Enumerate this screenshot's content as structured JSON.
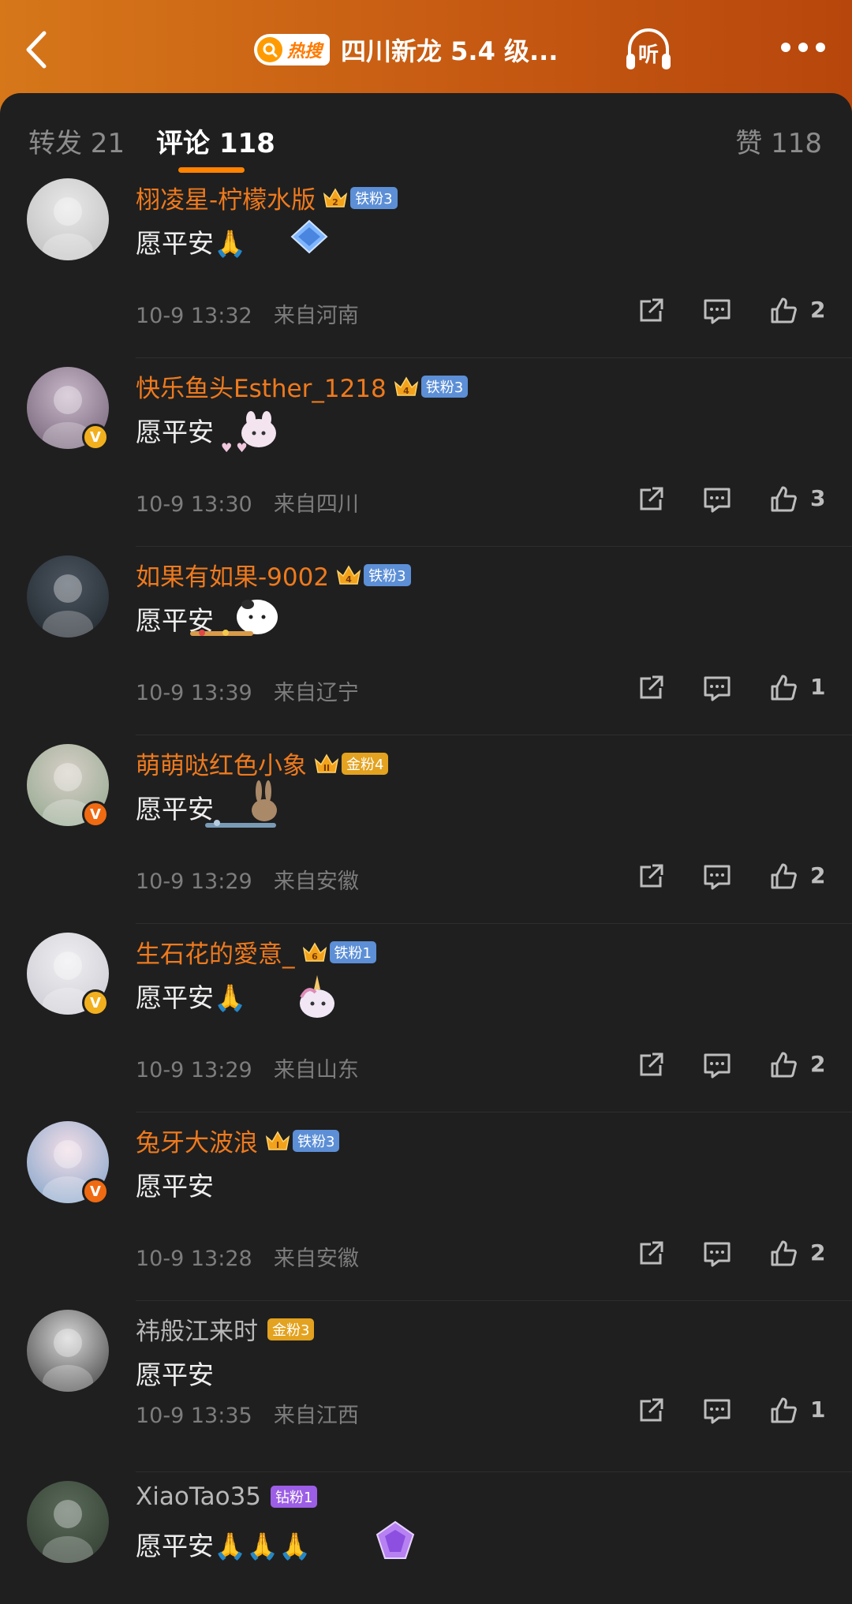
{
  "header": {
    "hot_label": "热搜",
    "title": "四川新龙 5.4 级...",
    "listen_label": "听",
    "gradient_colors": [
      "#d6771a",
      "#b7460c"
    ]
  },
  "tabs": {
    "repost": "转发 21",
    "comment": "评论 118",
    "like": "赞 118",
    "accent": "#ff8200"
  },
  "comments": [
    {
      "user": "栩凌星-柠檬水版",
      "name_color": "orange",
      "crown": "2",
      "fan_badge": "铁粉3",
      "badge_type": "iron",
      "verified": null,
      "text": "愿平安🙏",
      "time": "10-9 13:32",
      "location": "来自河南",
      "likes": "2",
      "sticker": "diamond"
    },
    {
      "user": "快乐鱼头Esther_1218",
      "name_color": "orange",
      "crown": "4",
      "fan_badge": "铁粉3",
      "badge_type": "iron",
      "verified": "yellow",
      "text": "愿平安",
      "time": "10-9 13:30",
      "location": "来自四川",
      "likes": "3",
      "sticker": "bunny"
    },
    {
      "user": "如果有如果-9002",
      "name_color": "orange",
      "crown": "4",
      "fan_badge": "铁粉3",
      "badge_type": "iron",
      "verified": null,
      "text": "愿平安",
      "time": "10-9 13:39",
      "location": "来自辽宁",
      "likes": "1",
      "sticker": "cat"
    },
    {
      "user": "萌萌哒红色小象",
      "name_color": "orange",
      "crown": "II",
      "fan_badge": "金粉4",
      "badge_type": "gold",
      "verified": "orange",
      "text": "愿平安",
      "time": "10-9 13:29",
      "location": "来自安徽",
      "likes": "2",
      "sticker": "rabbit"
    },
    {
      "user": "生石花的愛意_",
      "name_color": "orange",
      "crown": "6",
      "fan_badge": "铁粉1",
      "badge_type": "iron",
      "verified": "yellow",
      "text": "愿平安🙏",
      "time": "10-9 13:29",
      "location": "来自山东",
      "likes": "2",
      "sticker": "unicorn"
    },
    {
      "user": "兔牙大波浪",
      "name_color": "orange",
      "crown": "I",
      "fan_badge": "铁粉3",
      "badge_type": "iron",
      "verified": "orange",
      "text": "愿平安",
      "time": "10-9 13:28",
      "location": "来自安徽",
      "likes": "2",
      "sticker": "none"
    },
    {
      "user": "祎般江来时",
      "name_color": "gray",
      "crown": "",
      "fan_badge": "金粉3",
      "badge_type": "gold",
      "verified": null,
      "text": "愿平安",
      "time": "10-9 13:35",
      "location": "来自江西",
      "likes": "1",
      "sticker": "none"
    },
    {
      "user": "XiaoTao35",
      "name_color": "gray",
      "crown": "",
      "fan_badge": "钻粉1",
      "badge_type": "diamond",
      "verified": null,
      "text": "愿平安🙏🙏🙏",
      "time": "",
      "location": "",
      "likes": "",
      "sticker": "gem"
    }
  ]
}
